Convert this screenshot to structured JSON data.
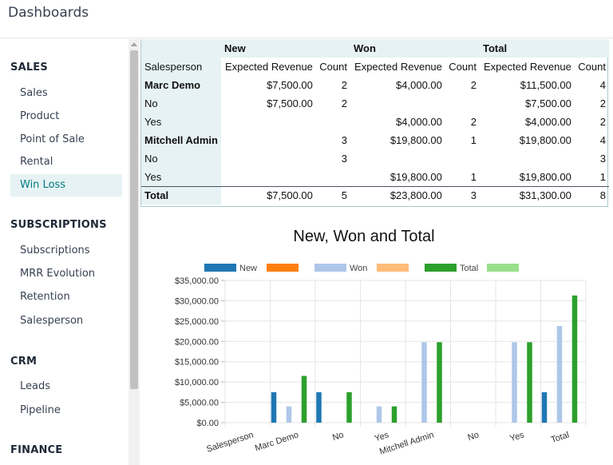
{
  "app": {
    "title": "Dashboards"
  },
  "sidebar": {
    "sections": [
      {
        "heading": "SALES",
        "items": [
          {
            "label": "Sales",
            "active": false
          },
          {
            "label": "Product",
            "active": false
          },
          {
            "label": "Point of Sale",
            "active": false
          },
          {
            "label": "Rental",
            "active": false
          },
          {
            "label": "Win Loss",
            "active": true
          }
        ]
      },
      {
        "heading": "SUBSCRIPTIONS",
        "items": [
          {
            "label": "Subscriptions",
            "active": false
          },
          {
            "label": "MRR Evolution",
            "active": false
          },
          {
            "label": "Retention",
            "active": false
          },
          {
            "label": "Salesperson",
            "active": false
          }
        ]
      },
      {
        "heading": "CRM",
        "items": [
          {
            "label": "Leads",
            "active": false
          },
          {
            "label": "Pipeline",
            "active": false
          }
        ]
      },
      {
        "heading": "FINANCE",
        "items": []
      }
    ]
  },
  "pivot": {
    "group_headers": [
      "New",
      "Won",
      "Total"
    ],
    "row_header_label": "Salesperson",
    "measure_headers": [
      "Expected Revenue",
      "Count",
      "Expected Revenue",
      "Count",
      "Expected Revenue",
      "Count"
    ],
    "rows": [
      {
        "label": "Marc Demo",
        "bold": true,
        "cells": [
          "$7,500.00",
          "2",
          "$4,000.00",
          "2",
          "$11,500.00",
          "4"
        ]
      },
      {
        "label": "No",
        "bold": false,
        "cells": [
          "$7,500.00",
          "2",
          "",
          "",
          "$7,500.00",
          "2"
        ]
      },
      {
        "label": "Yes",
        "bold": false,
        "cells": [
          "",
          "",
          "$4,000.00",
          "2",
          "$4,000.00",
          "2"
        ]
      },
      {
        "label": "Mitchell Admin",
        "bold": true,
        "cells": [
          "",
          "3",
          "$19,800.00",
          "1",
          "$19,800.00",
          "4"
        ]
      },
      {
        "label": "No",
        "bold": false,
        "cells": [
          "",
          "3",
          "",
          "",
          "",
          "3"
        ]
      },
      {
        "label": "Yes",
        "bold": false,
        "cells": [
          "",
          "",
          "$19,800.00",
          "1",
          "$19,800.00",
          "1"
        ]
      }
    ],
    "total_row": {
      "label": "Total",
      "cells": [
        "$7,500.00",
        "5",
        "$23,800.00",
        "3",
        "$31,300.00",
        "8"
      ]
    }
  },
  "chart_data": {
    "type": "bar",
    "title": "New, Won and Total",
    "categories": [
      "Salesperson",
      "Marc Demo",
      "No",
      "Yes",
      "Mitchell Admin",
      "No",
      "Yes",
      "Total"
    ],
    "ylim": [
      0,
      35000
    ],
    "yticks": [
      "$0.00",
      "$5,000.00",
      "$10,000.00",
      "$15,000.00",
      "$20,000.00",
      "$25,000.00",
      "$30,000.00",
      "$35,000.00"
    ],
    "legend_position": "top",
    "legend": [
      {
        "name": "New",
        "color": "#1f77b4"
      },
      {
        "name": "",
        "color": "#ff7f0e"
      },
      {
        "name": "Won",
        "color": "#aec7e8"
      },
      {
        "name": "",
        "color": "#ffbb78"
      },
      {
        "name": "Total",
        "color": "#2ca02c"
      },
      {
        "name": "",
        "color": "#98df8a"
      }
    ],
    "series": [
      {
        "name": "New",
        "color": "#1f77b4",
        "values": [
          0,
          7500,
          7500,
          0,
          0,
          0,
          0,
          7500
        ]
      },
      {
        "name": "",
        "color": "#ff7f0e",
        "values": [
          0,
          0,
          0,
          0,
          0,
          0,
          0,
          0
        ]
      },
      {
        "name": "Won",
        "color": "#aec7e8",
        "values": [
          0,
          4000,
          0,
          4000,
          19800,
          0,
          19800,
          23800
        ]
      },
      {
        "name": "",
        "color": "#ffbb78",
        "values": [
          0,
          0,
          0,
          0,
          0,
          0,
          0,
          0
        ]
      },
      {
        "name": "Total",
        "color": "#2ca02c",
        "values": [
          0,
          11500,
          7500,
          4000,
          19800,
          0,
          19800,
          31300
        ]
      },
      {
        "name": "",
        "color": "#98df8a",
        "values": [
          0,
          0,
          0,
          0,
          0,
          0,
          0,
          0
        ]
      }
    ]
  }
}
